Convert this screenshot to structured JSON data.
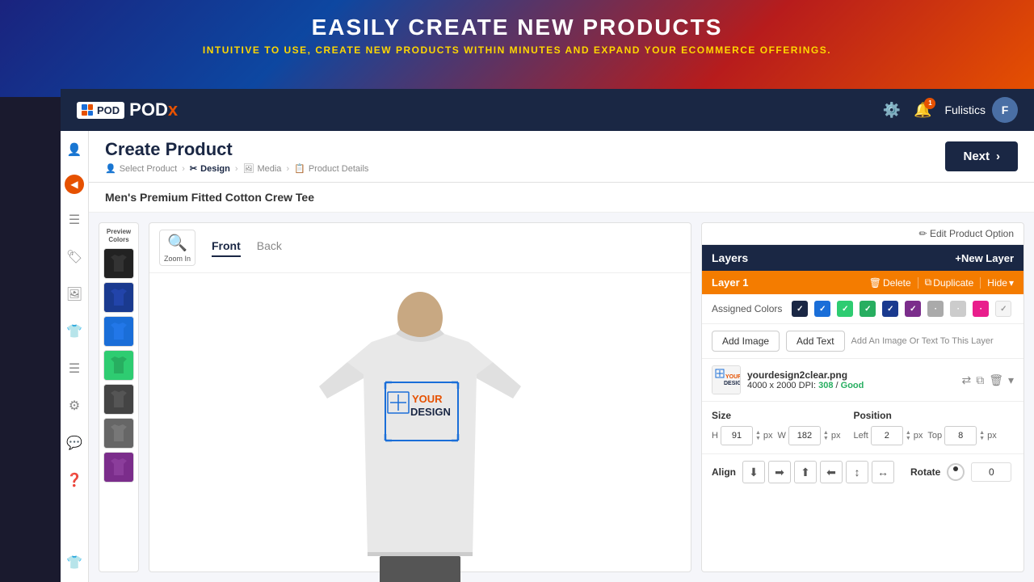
{
  "hero": {
    "title": "EASILY CREATE NEW PRODUCTS",
    "subtitle": "INTUITIVE TO USE, CREATE NEW PRODUCTS WITHIN MINUTES AND EXPAND YOUR ECOMMERCE OFFERINGS."
  },
  "nav": {
    "logo_text": "POD",
    "logo_x": "x",
    "settings_icon": "⚙",
    "notification_icon": "🔔",
    "notification_count": "1",
    "user_name": "Fulistics",
    "avatar_letter": "F"
  },
  "header": {
    "page_title": "Create Product",
    "next_btn": "Next",
    "breadcrumbs": [
      {
        "label": "Select Product",
        "icon": "👤",
        "active": false
      },
      {
        "label": "Design",
        "icon": "✂",
        "active": true
      },
      {
        "label": "Media",
        "icon": "🖼",
        "active": false
      },
      {
        "label": "Product Details",
        "icon": "📋",
        "active": false
      }
    ]
  },
  "product": {
    "name": "Men's Premium Fitted Cotton Crew Tee",
    "views": [
      "Front",
      "Back"
    ],
    "active_view": "Front",
    "zoom_label": "Zoom In"
  },
  "preview_colors": {
    "label": "Preview Colors",
    "swatches": [
      {
        "color": "#222",
        "name": "Black"
      },
      {
        "color": "#1a3a8f",
        "name": "Navy"
      },
      {
        "color": "#1a6ed8",
        "name": "Royal Blue"
      },
      {
        "color": "#2ecc71",
        "name": "Green"
      },
      {
        "color": "#333",
        "name": "Charcoal"
      },
      {
        "color": "#555",
        "name": "Dark Gray"
      },
      {
        "color": "#7b2d8b",
        "name": "Purple"
      }
    ]
  },
  "layers": {
    "title": "Layers",
    "new_layer_btn": "+New Layer",
    "layer1": {
      "name": "Layer 1",
      "delete_btn": "Delete",
      "duplicate_btn": "Duplicate",
      "hide_btn": "Hide"
    },
    "assigned_colors_label": "Assigned Colors",
    "color_checks": [
      {
        "color": "#1a2744",
        "checked": true
      },
      {
        "color": "#1a6ed8",
        "checked": true
      },
      {
        "color": "#2ecc71",
        "checked": true
      },
      {
        "color": "#27ae60",
        "checked": true
      },
      {
        "color": "#1a3a8f",
        "checked": true
      },
      {
        "color": "#7b2d8b",
        "checked": true
      },
      {
        "color": "#aaa",
        "checked": false
      },
      {
        "color": "#ccc",
        "checked": false
      },
      {
        "color": "#e91e8c",
        "checked": false
      },
      {
        "color": "#eee",
        "checked": true
      }
    ],
    "add_image_btn": "Add Image",
    "add_text_btn": "Add Text",
    "add_hint": "Add An Image Or Text To This Layer",
    "file": {
      "name": "yourdesign2clear.png",
      "dimensions": "4000 x 2000",
      "dpi_label": "DPI:",
      "dpi_value": "308",
      "dpi_quality": "Good"
    },
    "size": {
      "label": "Size",
      "h_label": "H",
      "h_value": "91",
      "w_label": "W",
      "w_value": "182",
      "unit": "px"
    },
    "position": {
      "label": "Position",
      "left_label": "Left",
      "left_value": "2",
      "top_label": "Top",
      "top_value": "8",
      "unit": "px"
    },
    "align": {
      "label": "Align",
      "buttons": [
        "⬇",
        "➡",
        "⬆",
        "⬅",
        "↕",
        "↔"
      ]
    },
    "rotate": {
      "label": "Rotate",
      "value": "0"
    }
  },
  "edit_product_option": "Edit Product Option",
  "sidebar_icons": [
    "👤",
    "☰",
    "🏷",
    "🖼",
    "👕",
    "☰",
    "⚙",
    "💬",
    "❓",
    "👕"
  ]
}
